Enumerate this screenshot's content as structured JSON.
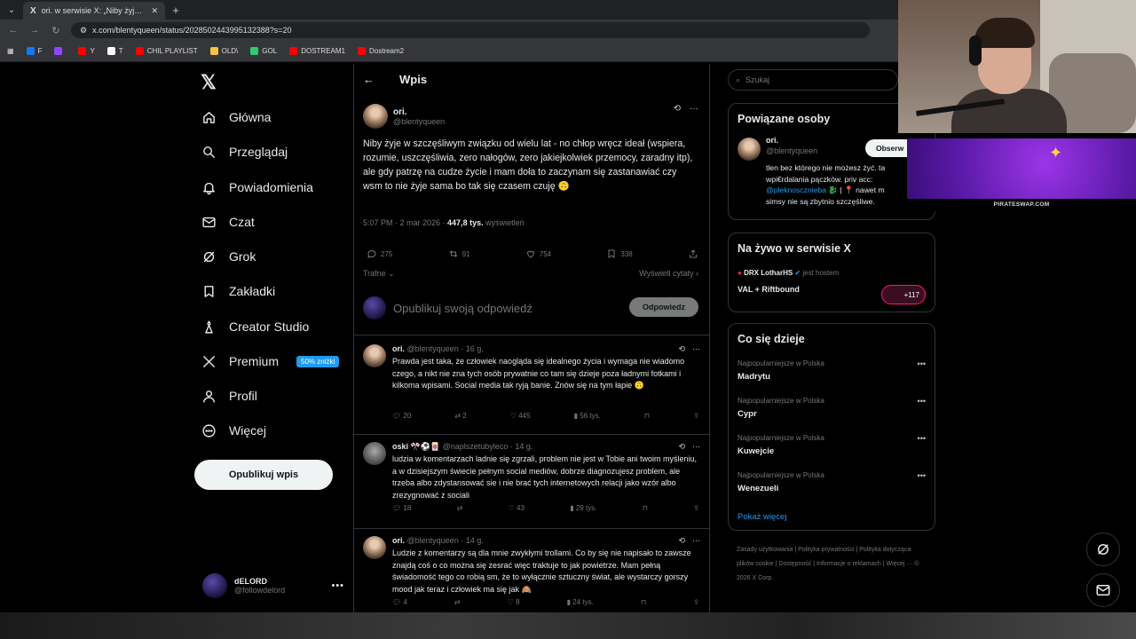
{
  "browser": {
    "tab_title": "ori. w serwisie X: „Niby żyje w s...",
    "url": "x.com/blentyqueen/status/2028502443995132388?s=20",
    "bookmarks": [
      {
        "label": "F",
        "color": "#1877f2"
      },
      {
        "label": "",
        "color": "#9146ff"
      },
      {
        "label": "Y",
        "color": "#ff0000"
      },
      {
        "label": "T",
        "color": "#ffffff"
      },
      {
        "label": "CHIL PLAYLIST",
        "color": "#ff0000"
      },
      {
        "label": "OLD\\",
        "color": "#f5c542"
      },
      {
        "label": "GOL",
        "color": "#2ecc71"
      },
      {
        "label": "DOSTREAM1",
        "color": "#ff0000"
      },
      {
        "label": "Dostream2",
        "color": "#ff0000"
      }
    ]
  },
  "nav": {
    "items": [
      {
        "label": "Główna",
        "icon": "home-icon"
      },
      {
        "label": "Przeglądaj",
        "icon": "search-icon"
      },
      {
        "label": "Powiadomienia",
        "icon": "bell-icon"
      },
      {
        "label": "Czat",
        "icon": "mail-icon"
      },
      {
        "label": "Grok",
        "icon": "grok-icon"
      },
      {
        "label": "Zakładki",
        "icon": "bookmark-icon"
      },
      {
        "label": "Creator Studio",
        "icon": "creator-icon"
      },
      {
        "label": "Premium",
        "icon": "x-icon",
        "badge": "50% zniżki"
      },
      {
        "label": "Profil",
        "icon": "person-icon"
      },
      {
        "label": "Więcej",
        "icon": "more-circle-icon"
      }
    ],
    "publish_label": "Opublikuj wpis",
    "me": {
      "name": "dELORD",
      "handle": "@followdelord"
    }
  },
  "main": {
    "title": "Wpis",
    "post": {
      "name": "ori.",
      "handle": "@blentyqueen",
      "text": "Niby żyje w szczęśliwym związku od wielu lat - no chłop wręcz ideał (wspiera, rozumie, uszczęśliwia, zero nałogów, zero jakiejkolwiek przemocy, zaradny itp), ale gdy patrzę na cudze życie i mam doła to zaczynam się zastanawiać czy wsm to nie żyje sama bo tak się czasem czuję 🙃",
      "time": "5:07 PM · 2 mar 2026 · ",
      "views_value": "447,8 tys.",
      "views_label": " wyświetleń",
      "stats": {
        "replies": "275",
        "reposts": "91",
        "likes": "754",
        "bookmarks": "338"
      }
    },
    "sort_label": "Trafne ⌄",
    "quotes_label": "Wyświetl cytaty ›",
    "reply_placeholder": "Opublikuj swoją odpowiedź",
    "reply_button": "Odpowiedz",
    "replies": [
      {
        "name": "ori.",
        "meta": " @blentyqueen · 16 g.",
        "text": "Prawda jest taka, że człowiek naogląda się idealnego życia i wymaga nie wiadomo czego, a nikt nie zna tych osób prywatnie co tam się dzieje poza ładnymi fotkami i kilkoma wpisami. Social media tak ryją banie. Znów się na tym łapie 🙃",
        "replies": "20",
        "reposts": "2",
        "likes": "445",
        "views": "56 tys."
      },
      {
        "name": "oski 🎌⚽🀄",
        "meta": " @naplszetubyleco · 14 g.",
        "text": "ludzia w komentarzach ladnie się zgrzali, problem nie jest w Tobie ani twoim myśleniu, a w dzisiejszym świecie pełnym social mediów, dobrze diagnozujesz problem, ale trzeba albo zdystansować sie i nie brać tych internetowych relacji jako wzór albo zrezygnować z sociali",
        "replies": "18",
        "reposts": "",
        "likes": "43",
        "views": "29 tys."
      },
      {
        "name": "ori.",
        "meta": " @blentyqueen · 14 g.",
        "text": "Ludzie z komentarzy są dla mnie zwykłymi trollami. Co by się nie napisało to zawsze znajdą coś o co można się zesrać więc traktuje to jak powietrze. Mam pełną świadomość tego co robią sm, że to wyłącznie sztuczny świat, ale wystarczy gorszy mood jak teraz i człowiek ma się jak 🙈",
        "replies": "4",
        "reposts": "",
        "likes": "8",
        "views": "24 tys."
      }
    ]
  },
  "right": {
    "search_placeholder": "Szukaj",
    "related": {
      "title": "Powiązane osoby",
      "name": "ori.",
      "handle": "@blentyqueen",
      "follow": "Obserw",
      "bio_1": "tlen bez którego nie możesz żyć. ta",
      "bio_2": "wpi€rdalania pączków. priv acc:",
      "bio_link": "@pleknoscznieba",
      "bio_3": " 🐉 | 📍 nawet m",
      "bio_4": "simsy nie są zbytnio szczęśliwe."
    },
    "live": {
      "title": "Na żywo w serwisie X",
      "host": "DRX LotharHS",
      "host_suffix": " jest hostem",
      "stream": "VAL + Riftbound",
      "count": "+117"
    },
    "trends": {
      "title": "Co się dzieje",
      "items": [
        {
          "category": "Najpopularniejsze w Polska",
          "name": "Madrytu"
        },
        {
          "category": "Najpopularniejsze w Polska",
          "name": "Cypr"
        },
        {
          "category": "Najpopularniejsze w Polska",
          "name": "Kuwejcie"
        },
        {
          "category": "Najpopularniejsze w Polska",
          "name": "Wenezueli"
        }
      ],
      "show_more": "Pokaż więcej"
    },
    "footer": "Zasady użytkowania | Polityka prywatności | Polityka dotycząca plików cookie | Dostępność | Informacje o reklamach | Więcej ··· © 2026 X Corp."
  },
  "overlay": {
    "promo_label": "PIRATESWAP.COM"
  }
}
